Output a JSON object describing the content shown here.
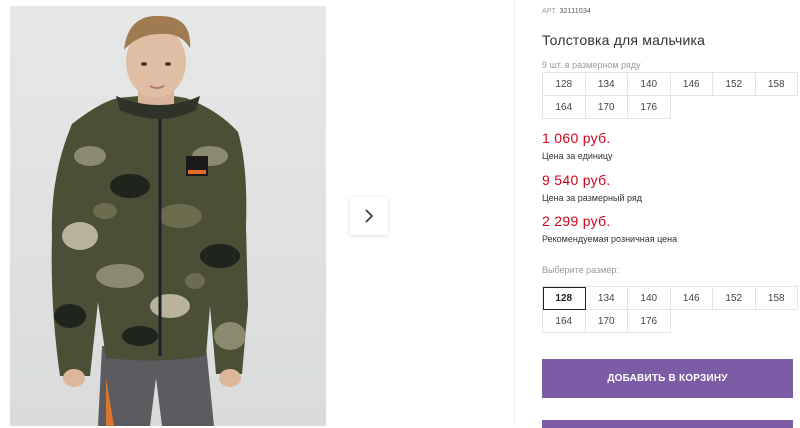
{
  "product": {
    "article_label": "АРТ.",
    "article_number": "32111034",
    "title": "Толстовка для мальчика",
    "size_run_caption": "9 шт. в размерном ряду",
    "size_run": [
      "128",
      "134",
      "140",
      "146",
      "152",
      "158",
      "164",
      "170",
      "176"
    ]
  },
  "prices": [
    {
      "value": "1 060 руб.",
      "label": "Цена за единицу"
    },
    {
      "value": "9 540 руб.",
      "label": "Цена за размерный ряд"
    },
    {
      "value": "2 299 руб.",
      "label": "Рекомендуемая розничная цена"
    }
  ],
  "size_select": {
    "caption": "Выберите размер:",
    "sizes": [
      "128",
      "134",
      "140",
      "146",
      "152",
      "158",
      "164",
      "170",
      "176"
    ],
    "selected": "128"
  },
  "actions": {
    "add_to_cart": "ДОБАВИТЬ В КОРЗИНУ"
  },
  "icons": {
    "next": "chevron-right-icon"
  },
  "colors": {
    "price": "#d0021b",
    "button": "#7d5ca6",
    "jacket_base": "#4a4f36"
  }
}
